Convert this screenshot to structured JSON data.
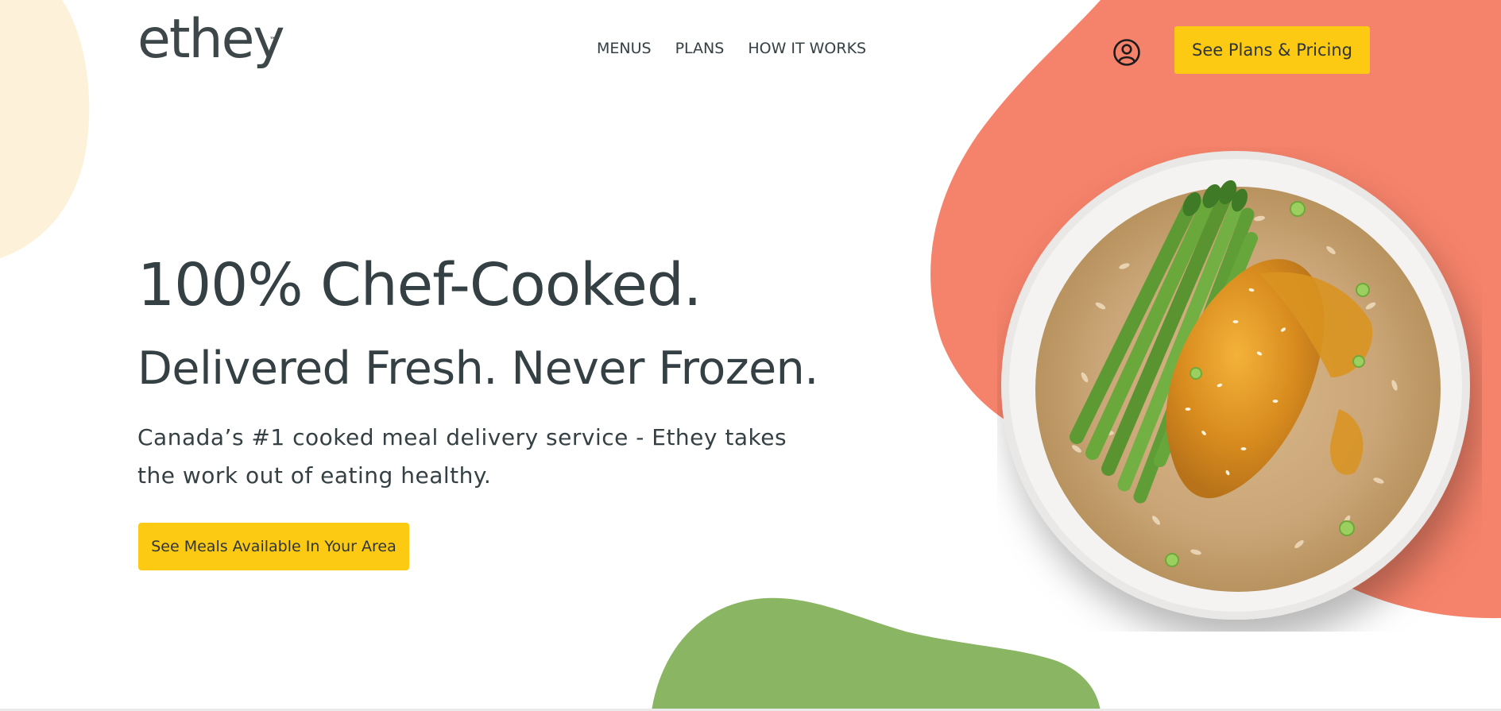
{
  "brand": {
    "logo_text": "ethey",
    "trademark": "™"
  },
  "nav": {
    "items": [
      {
        "label": "MENUS"
      },
      {
        "label": "PLANS"
      },
      {
        "label": "HOW IT WORKS"
      }
    ]
  },
  "header": {
    "account_icon": "user-circle-icon",
    "cta_label": "See Plans & Pricing"
  },
  "hero": {
    "title": "100% Chef-Cooked.",
    "subtitle": "Delivered Fresh. Never Frozen.",
    "body": "Canada’s #1 cooked meal delivery service - Ethey takes the work out of eating healthy.",
    "cta_label": "See Meals Available In Your Area",
    "image": "meal-bowl-chicken-asparagus-rice"
  },
  "colors": {
    "accent_yellow": "#fcca12",
    "coral": "#f5826a",
    "green": "#8ab563",
    "cream": "#fdf2d9",
    "text": "#344043"
  }
}
